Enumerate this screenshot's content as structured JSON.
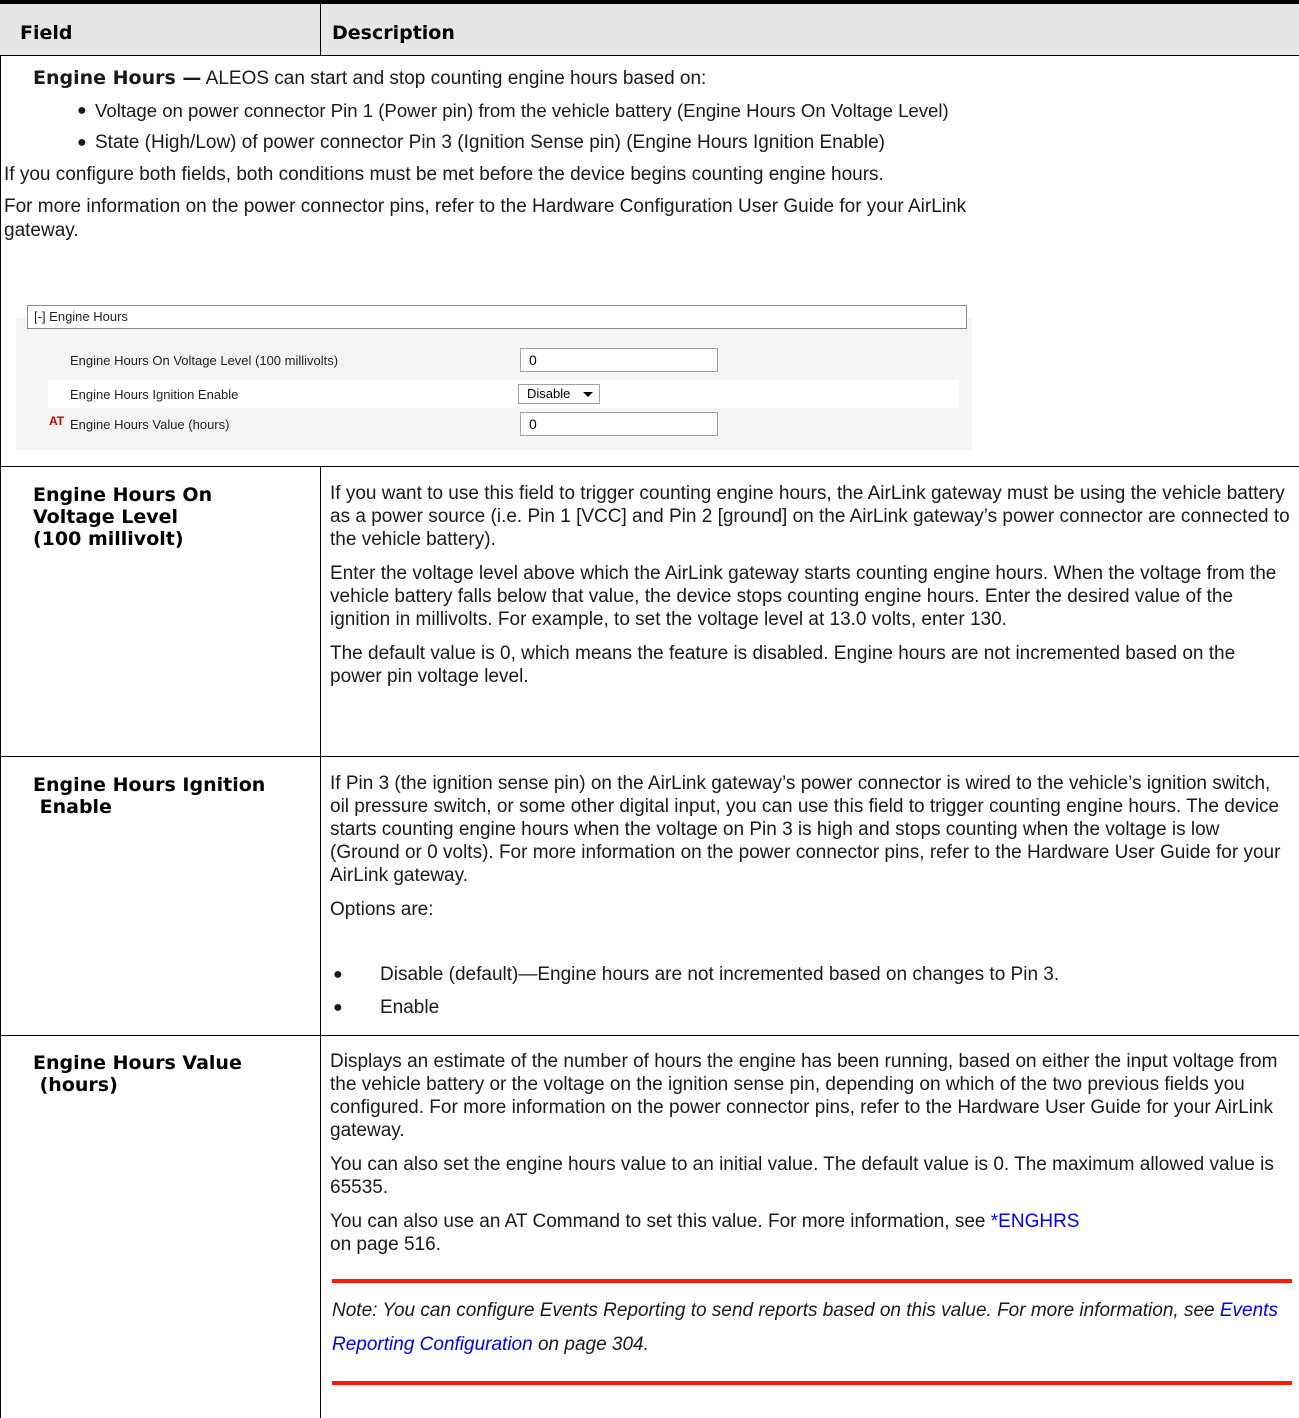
{
  "table_header": {
    "field": "Field",
    "description": "Description"
  },
  "intro": {
    "lead_bold": "Engine Hours —",
    "lead_text": " ALEOS can start and stop counting engine hours based on:",
    "bullets": [
      "Voltage on power connector Pin 1 (Power pin) from the vehicle battery (Engine Hours On Voltage Level)",
      "State (High/Low) of power connector Pin 3 (Ignition Sense pin) (Engine Hours Ignition Enable)"
    ],
    "para1": "If you configure both fields, both conditions must be met before the device begins counting engine hours.",
    "para2_line1": "For more information on the power connector pins, refer to the Hardware Configuration User Guide for your AirLink",
    "para2_line2": "gateway."
  },
  "screenshot": {
    "section_title": "[-] Engine Hours",
    "rows": [
      {
        "label": "Engine Hours On Voltage Level (100 millivolts)",
        "value": "0"
      },
      {
        "label": "Engine Hours Ignition Enable",
        "selected": "Disable"
      },
      {
        "label": "Engine Hours Value (hours)",
        "value": "0",
        "badge": "AT"
      }
    ]
  },
  "rows": [
    {
      "field_lines": [
        "Engine Hours On",
        "Voltage Level",
        "(100 millivolt)"
      ],
      "paragraphs": [
        "If you want to use this field to trigger counting engine hours, the AirLink gateway must be using the vehicle battery as a power source (i.e. Pin 1 [VCC] and Pin 2 [ground] on the AirLink gateway’s power connector are connected to the vehicle battery).",
        "Enter the voltage level above which the AirLink gateway starts counting engine hours. When the voltage from the vehicle battery falls below that value, the device stops counting engine hours. Enter the desired value of the ignition in millivolts. For example, to set the voltage level at 13.0 volts, enter 130.",
        "The default value is 0, which means the feature is disabled. Engine hours are not incremented based on the power pin voltage level."
      ]
    },
    {
      "field_lines": [
        "Engine Hours Ignition",
        " Enable"
      ],
      "paragraphs": [
        "If Pin 3 (the ignition sense pin) on the AirLink gateway’s power connector is wired to the vehicle’s ignition switch, oil pressure switch, or some other digital input, you can use this field to trigger counting engine hours. The device starts counting engine hours when the voltage on Pin 3 is high and stops counting when the voltage is low (Ground or 0 volts). For more information on the power connector pins, refer to the Hardware User Guide for your AirLink gateway.",
        "Options are:"
      ],
      "options": [
        "Disable (default)—Engine hours are not incremented based on changes to Pin 3.",
        "Enable"
      ]
    },
    {
      "field_lines": [
        "Engine Hours Value",
        " (hours)"
      ],
      "paragraphs": [
        "Displays an estimate of the number of hours the engine has been running, based on either the input voltage from the vehicle battery or the voltage on the ignition sense pin, depending on which of the two previous fields you configured. For more information on the power connector pins, refer to the Hardware User Guide for your AirLink gateway.",
        "You can also set the engine hours value to an initial value. The default value is 0. The maximum allowed value is 65535."
      ],
      "at_para_before": "You can also use an AT Command to set this value. For more information, see ",
      "at_link": "*ENGHRS",
      "at_para_after": "on page 516.",
      "note_before": "Note:  You can configure Events Reporting to send reports based on this value. For more information, see ",
      "note_link": "Events Reporting Configuration",
      "note_after": " on page 304."
    }
  ],
  "colors": {
    "header_bg": "#e6e6e6",
    "link": "#0000ee",
    "note_rule": "#ff1a00",
    "at_badge": "#cc0000"
  }
}
